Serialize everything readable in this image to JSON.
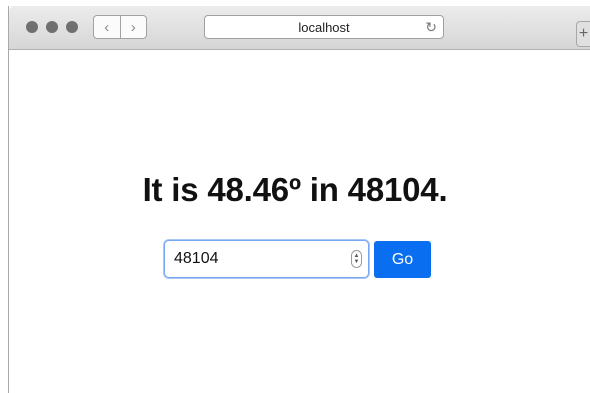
{
  "browser": {
    "address": "localhost",
    "back_label": "‹",
    "forward_label": "›",
    "reload_label": "↻",
    "new_tab_label": "+"
  },
  "page": {
    "headline": "It is 48.46º in 48104.",
    "zip_input_value": "48104",
    "go_label": "Go"
  },
  "colors": {
    "button_blue": "#0a6ef0",
    "focus_ring": "#76a8f4"
  }
}
